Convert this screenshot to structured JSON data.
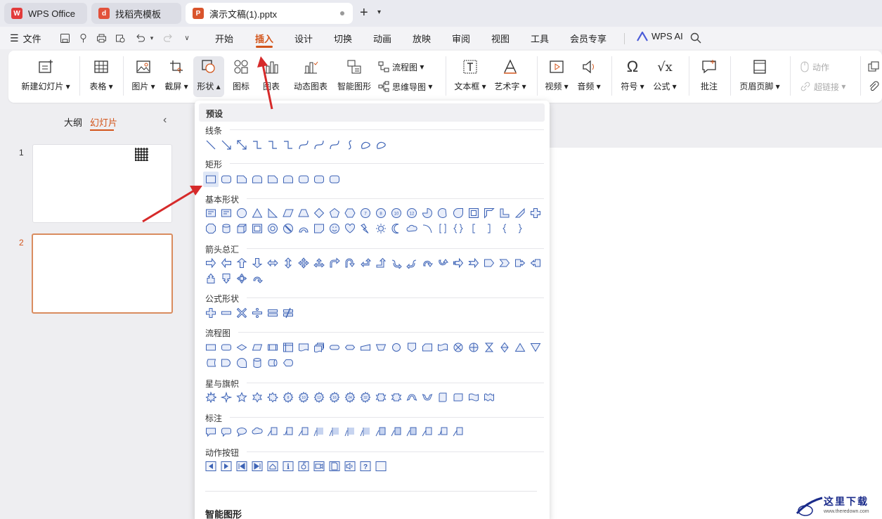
{
  "tabs": [
    {
      "label": "WPS Office"
    },
    {
      "label": "找稻壳模板"
    },
    {
      "label": "演示文稿(1).pptx"
    }
  ],
  "menu": {
    "file_label": "文件",
    "items": [
      "开始",
      "插入",
      "设计",
      "切换",
      "动画",
      "放映",
      "审阅",
      "视图",
      "工具",
      "会员专享"
    ],
    "active": "插入",
    "wps_ai": "WPS AI"
  },
  "ribbon": {
    "new_slide": "新建幻灯片",
    "table": "表格",
    "picture": "图片",
    "screenshot": "截屏",
    "shape": "形状",
    "icon": "图标",
    "chart": "图表",
    "dynamic_chart": "动态图表",
    "smart_shape": "智能图形",
    "flowchart": "流程图",
    "mindmap": "思维导图",
    "textbox": "文本框",
    "wordart": "艺术字",
    "video": "视频",
    "audio": "音频",
    "symbol": "符号",
    "formula": "公式",
    "comment": "批注",
    "header_footer": "页眉页脚",
    "action": "动作",
    "hyperlink": "超链接"
  },
  "left_panel": {
    "outline_tab": "大纲",
    "slides_tab": "幻灯片",
    "slides": [
      {
        "number": "1"
      },
      {
        "number": "2"
      }
    ]
  },
  "shape_panel": {
    "header": "预设",
    "sections": {
      "lines": "线条",
      "rect": "矩形",
      "basic": "基本形状",
      "arrows": "箭头总汇",
      "equation": "公式形状",
      "flowchart": "流程图",
      "stars": "星与旗帜",
      "callouts": "标注",
      "action": "动作按钮"
    },
    "footer": "智能图形"
  },
  "watermark": {
    "text": "这里下载",
    "sub": "www.theredown.com"
  },
  "colors": {
    "accent": "#d3551b",
    "shape_stroke": "#3d63b5",
    "arrow": "#d62a2a"
  }
}
